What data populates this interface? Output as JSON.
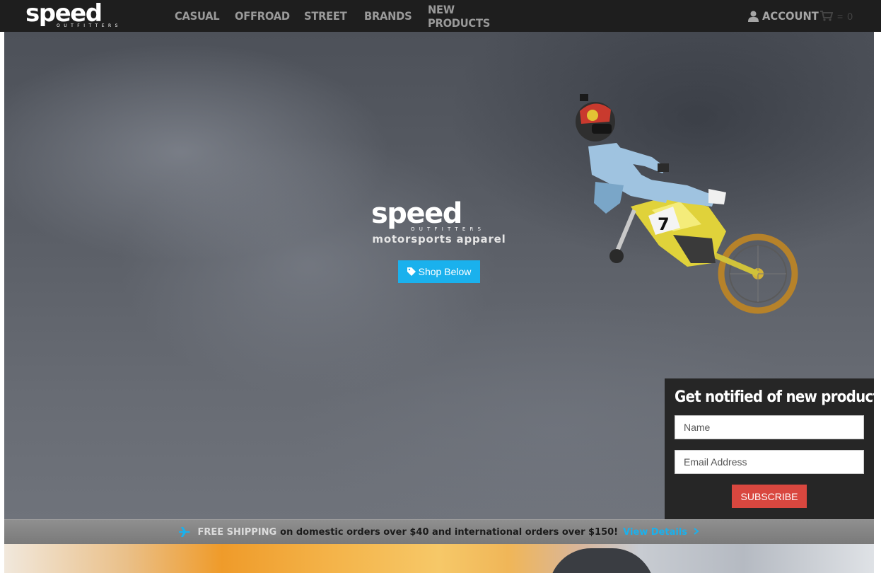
{
  "brand": {
    "name": "speed",
    "sub": "OUTFITTERS"
  },
  "nav": {
    "items": [
      "CASUAL",
      "OFFROAD",
      "STREET",
      "BRANDS",
      "NEW PRODUCTS"
    ],
    "account_label": "ACCOUNT",
    "cart_separator": "=",
    "cart_count": "0"
  },
  "hero": {
    "tagline": "motorsports apparel",
    "shop_button": "Shop Below",
    "rider_number": "7"
  },
  "signup": {
    "title": "Get notified of new products!",
    "name_placeholder": "Name",
    "email_placeholder": "Email Address",
    "subscribe_label": "SUBSCRIBE"
  },
  "shipping": {
    "highlight": "FREE SHIPPING",
    "text": "on domestic orders over $40 and international orders over $150!",
    "link": "View Details"
  },
  "colors": {
    "accent": "#1ab1ed",
    "subscribe": "#d9473f",
    "topbar": "#1e1e1e"
  },
  "icons": {
    "account": "user-icon",
    "cart": "cart-icon",
    "shop": "tag-icon",
    "shipping": "plane-icon",
    "details": "chevron-right-icon"
  }
}
